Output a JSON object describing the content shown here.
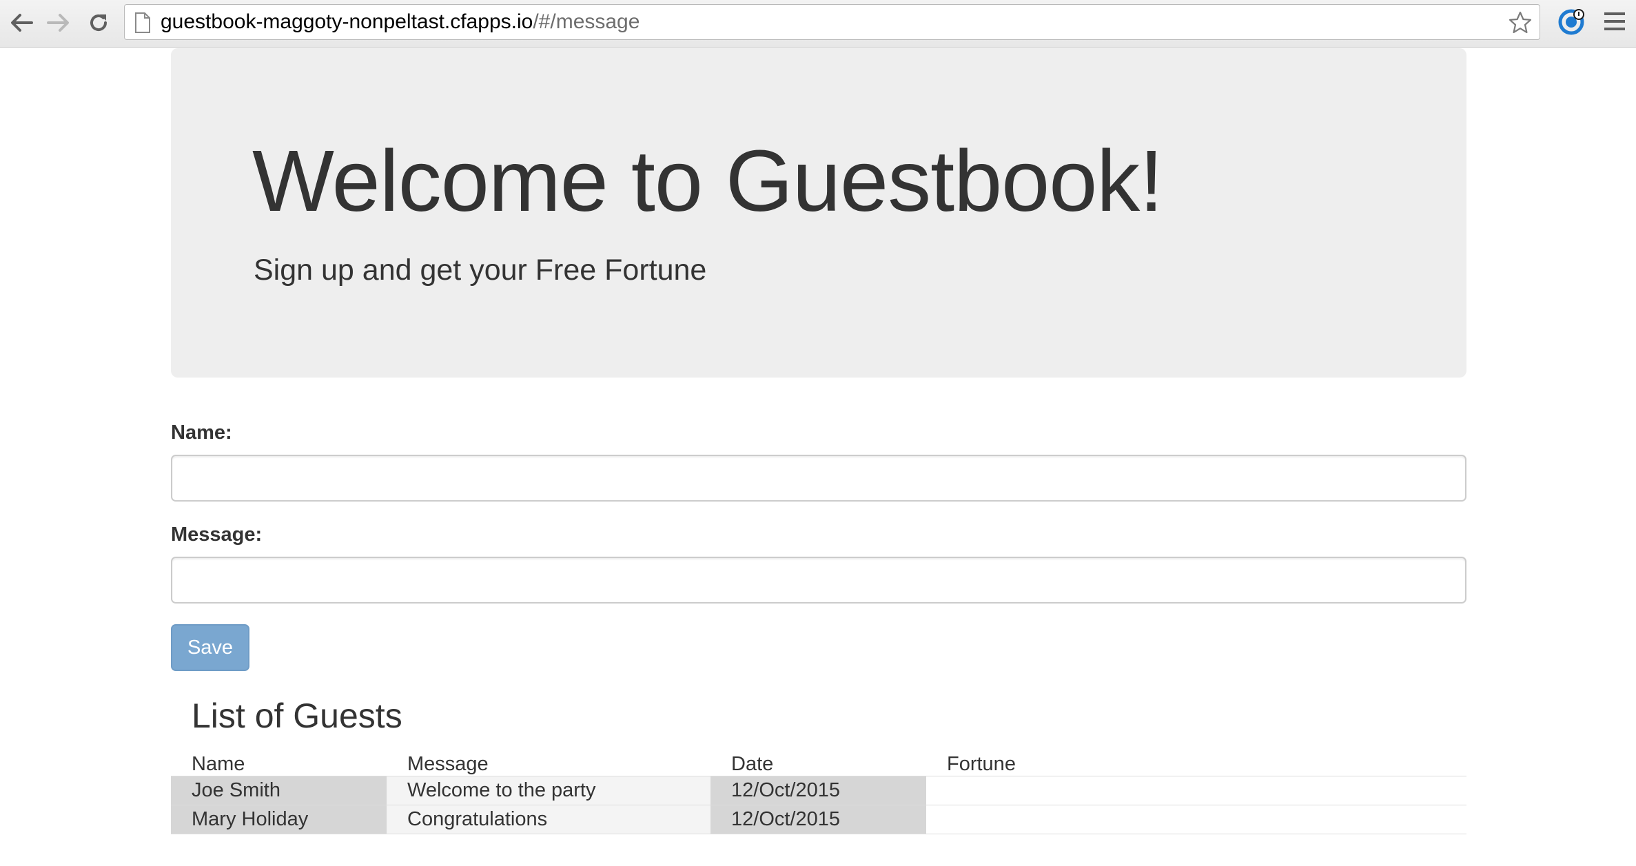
{
  "browser": {
    "url_host": "guestbook-maggoty-nonpeltast.cfapps.io",
    "url_path": "/#/message",
    "icons": [
      "back-arrow-icon",
      "forward-arrow-icon",
      "reload-icon",
      "page-icon",
      "star-icon",
      "extension-icon",
      "menu-icon"
    ]
  },
  "jumbotron": {
    "title": "Welcome to Guestbook!",
    "subtitle": "Sign up and get your Free Fortune"
  },
  "form": {
    "name_label": "Name:",
    "name_value": "",
    "message_label": "Message:",
    "message_value": "",
    "save_label": "Save"
  },
  "guests": {
    "title": "List of Guests",
    "columns": [
      "Name",
      "Message",
      "Date",
      "Fortune"
    ],
    "rows": [
      {
        "name": "Joe Smith",
        "message": "Welcome to the party",
        "date": "12/Oct/2015",
        "fortune": ""
      },
      {
        "name": "Mary Holiday",
        "message": "Congratulations",
        "date": "12/Oct/2015",
        "fortune": ""
      }
    ]
  },
  "colors": {
    "jumbotron_bg": "#eeeeee",
    "save_button_bg": "#7aa7d0",
    "text": "#333333",
    "cell_dark": "#d6d6d6",
    "cell_light": "#f4f4f4"
  }
}
